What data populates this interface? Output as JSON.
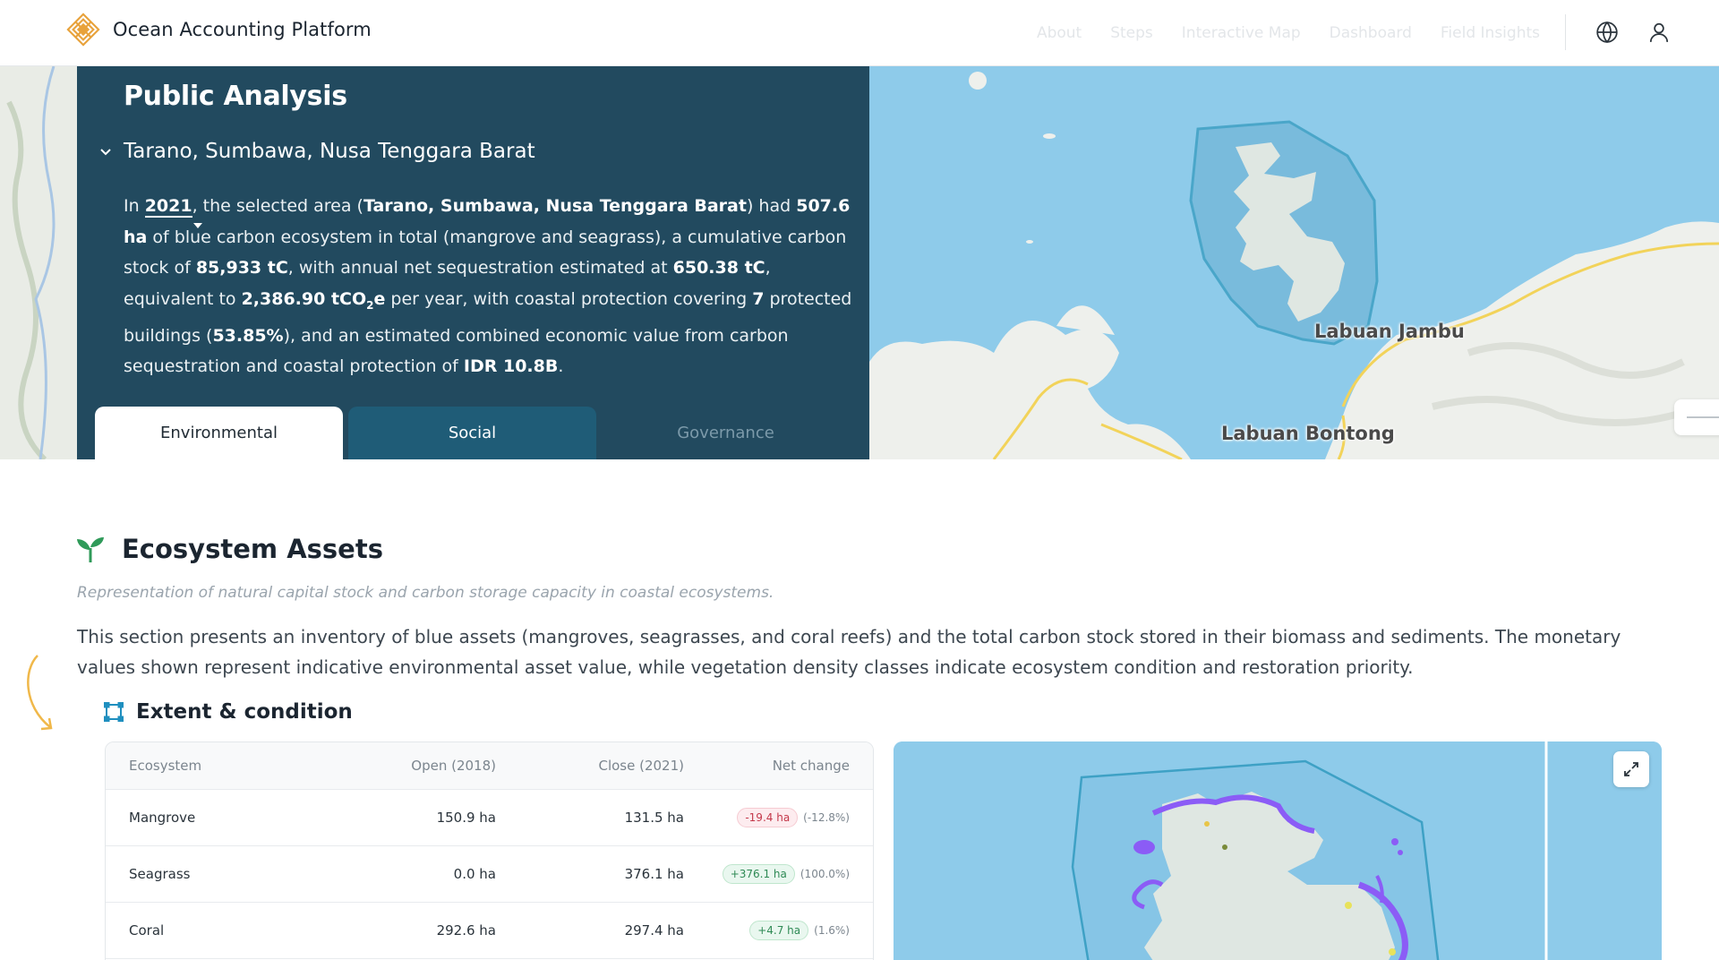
{
  "brand": {
    "name": "Ocean Accounting Platform",
    "logo_icon": "sun-diamond-logo-icon",
    "logo_color": "#e8a23b"
  },
  "nav": {
    "links": [
      "About",
      "Steps",
      "Interactive Map",
      "Dashboard",
      "Field Insights"
    ],
    "globe_icon": "globe-icon",
    "user_icon": "user-icon"
  },
  "panel": {
    "title": "Public Analysis",
    "location": "Tarano, Sumbawa, Nusa Tenggara Barat",
    "summary": {
      "t1": "In ",
      "year": "2021",
      "t2": ", the selected area (",
      "area": "Tarano, Sumbawa, Nusa Tenggara Barat",
      "t3": ") had ",
      "extent": "507.6 ha",
      "t4": " of blue carbon ecosystem in total (mangrove and seagrass), a cumulative carbon stock of ",
      "stock": "85,933 tC",
      "t5": ", with annual net sequestration estimated at ",
      "seq": "650.38 tC",
      "t6": ", equivalent to ",
      "co2_value": "2,386.90 tCO",
      "co2_sub": "2",
      "co2_e": "e",
      "t7": " per year, with coastal protection covering ",
      "buildings": "7",
      "t8": " protected buildings (",
      "share": "53.85%",
      "t9": "), and an estimated combined economic value from carbon sequestration and coastal protection of ",
      "value": "IDR 10.8B",
      "t10": "."
    },
    "tabs": {
      "environmental": "Environmental",
      "social": "Social",
      "governance": "Governance"
    }
  },
  "hero_map": {
    "labels": {
      "jambu": "Labuan Jambu",
      "bontong": "Labuan Bontong"
    },
    "water_color": "#8ecbea",
    "land_color": "#eef0ec"
  },
  "section": {
    "icon": "sprout-icon",
    "title": "Ecosystem Assets",
    "subtitle": "Representation of natural capital stock and carbon storage capacity in coastal ecosystems.",
    "description": "This section presents an inventory of blue assets (mangroves, seagrasses, and coral reefs) and the total carbon stock stored in their biomass and sediments. The monetary values shown represent indicative environmental asset value, while vegetation density classes indicate ecosystem condition and restoration priority."
  },
  "extent": {
    "icon": "polygon-select-icon",
    "title": "Extent & condition",
    "columns": [
      "Ecosystem",
      "Open (2018)",
      "Close (2021)",
      "Net change"
    ],
    "rows": [
      {
        "ecosystem": "Mangrove",
        "open": "150.9 ha",
        "close": "131.5 ha",
        "change": "-19.4 ha",
        "pct": "(-12.8%)",
        "trend": "neg"
      },
      {
        "ecosystem": "Seagrass",
        "open": "0.0 ha",
        "close": "376.1 ha",
        "change": "+376.1 ha",
        "pct": "(100.0%)",
        "trend": "pos"
      },
      {
        "ecosystem": "Coral",
        "open": "292.6 ha",
        "close": "297.4 ha",
        "change": "+4.7 ha",
        "pct": "(1.6%)",
        "trend": "pos"
      }
    ]
  },
  "mini_map": {
    "expand_icon": "expand-icon",
    "seagrass_color": "#8b5cf6"
  }
}
